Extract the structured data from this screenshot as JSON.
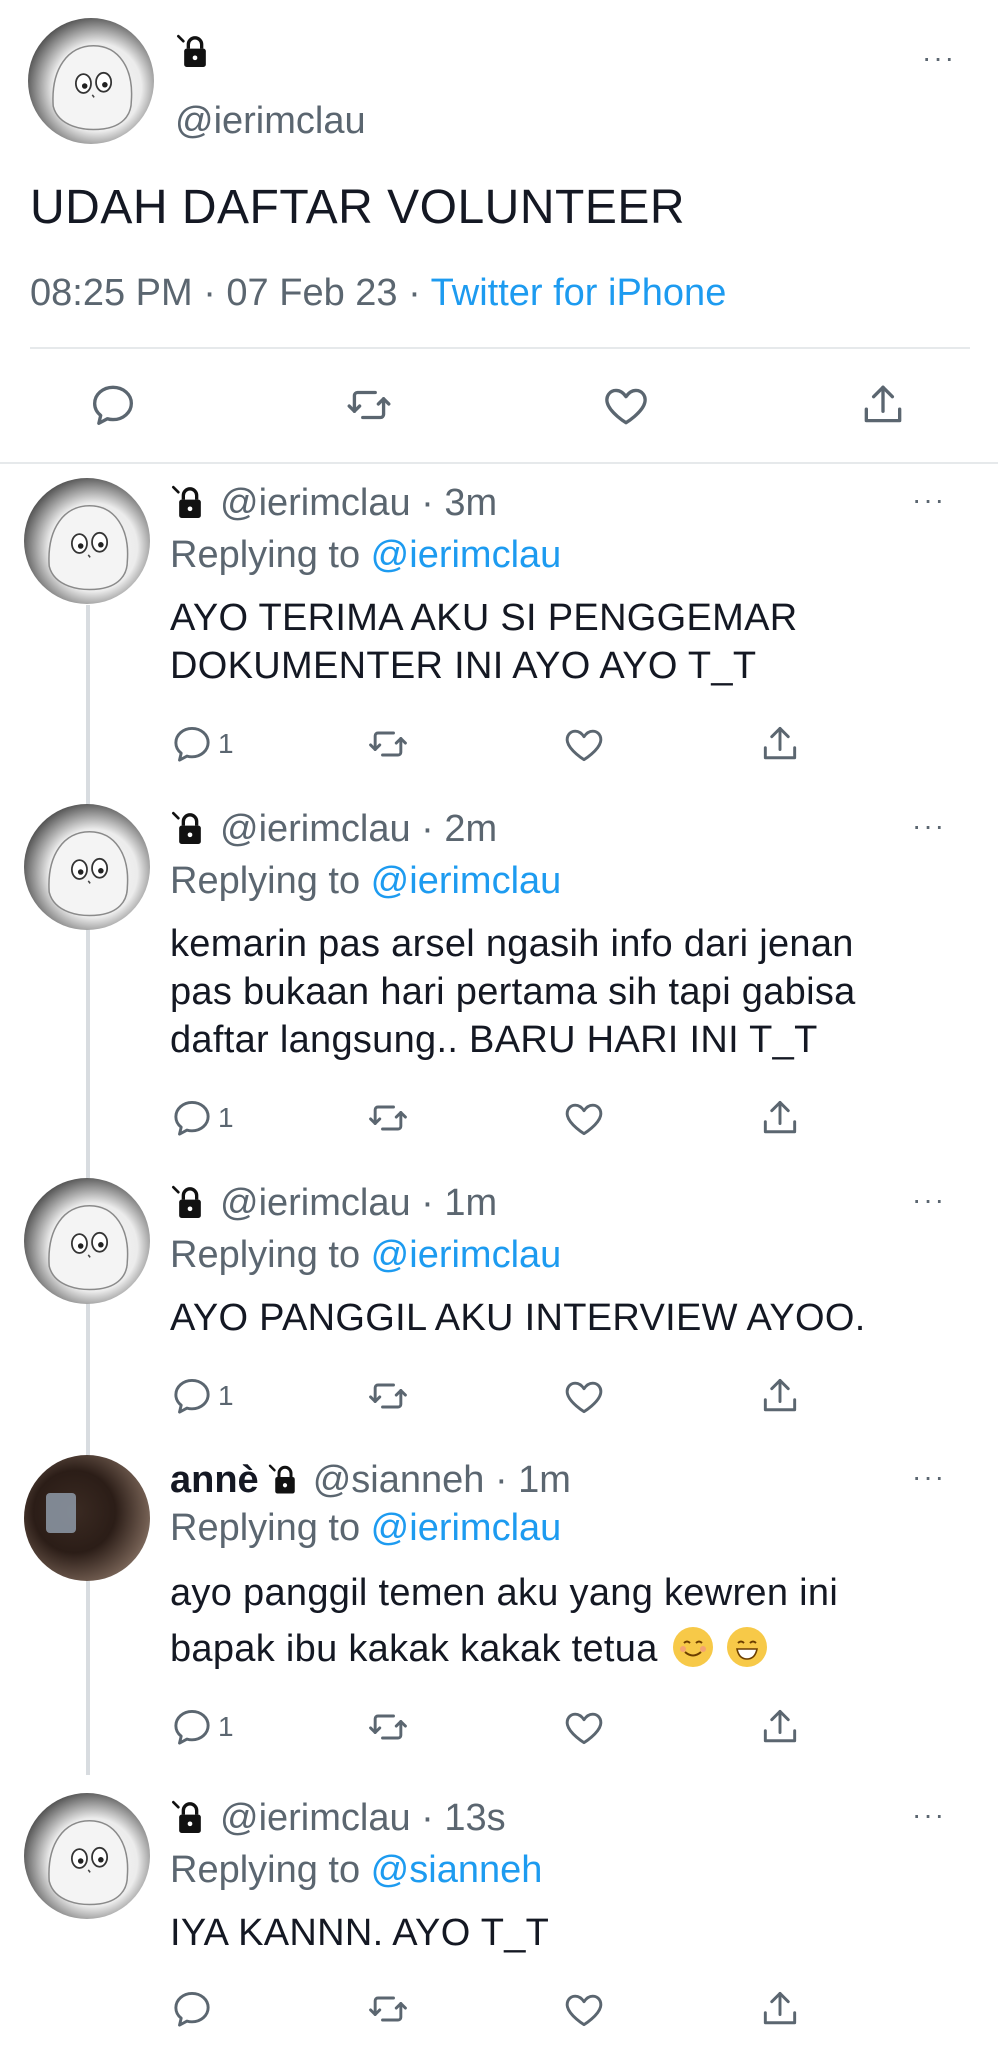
{
  "main_tweet": {
    "handle": "@ierimclau",
    "text": "UDAH DAFTAR VOLUNTEER",
    "time": "08:25 PM · 07 Feb 23 · ",
    "source": "Twitter for iPhone",
    "more_label": "···"
  },
  "replies": [
    {
      "display_name": "",
      "handle": "@ierimclau · 3m",
      "replying_prefix": "Replying to ",
      "replying_to": "@ierimclau",
      "lines": [
        "AYO TERIMA AKU SI PENGGEMAR",
        "DOKUMENTER INI AYO AYO T_T"
      ],
      "reply_count": "1",
      "more_label": "···"
    },
    {
      "display_name": "",
      "handle": "@ierimclau · 2m",
      "replying_prefix": "Replying to ",
      "replying_to": "@ierimclau",
      "lines": [
        "kemarin pas arsel ngasih info dari jenan",
        "pas bukaan hari pertama sih tapi gabisa",
        "daftar langsung.. BARU HARI INI T_T"
      ],
      "reply_count": "1",
      "more_label": "···"
    },
    {
      "display_name": "",
      "handle": "@ierimclau · 1m",
      "replying_prefix": "Replying to ",
      "replying_to": "@ierimclau",
      "lines": [
        "AYO PANGGIL AKU INTERVIEW AYOO."
      ],
      "reply_count": "1",
      "more_label": "···"
    },
    {
      "display_name": "annè",
      "handle": "@sianneh · 1m",
      "replying_prefix": "Replying to ",
      "replying_to": "@ierimclau",
      "lines": [
        "ayo panggil temen aku yang kewren ini",
        "bapak ibu kakak kakak tetua"
      ],
      "reply_count": "1",
      "more_label": "···"
    },
    {
      "display_name": "",
      "handle": "@ierimclau · 13s",
      "replying_prefix": "Replying to ",
      "replying_to": "@sianneh",
      "lines": [
        "IYA KANNN. AYO T_T"
      ],
      "reply_count": "",
      "more_label": "···"
    }
  ],
  "colors": {
    "accent": "#1d9bf0",
    "secondary_text": "#5b6670",
    "primary_text": "#141823",
    "divider": "#e6e9eb"
  },
  "icons": {
    "reply": "reply-icon",
    "retweet": "retweet-icon",
    "like": "heart-icon",
    "share": "share-icon",
    "lock": "lock-icon"
  }
}
